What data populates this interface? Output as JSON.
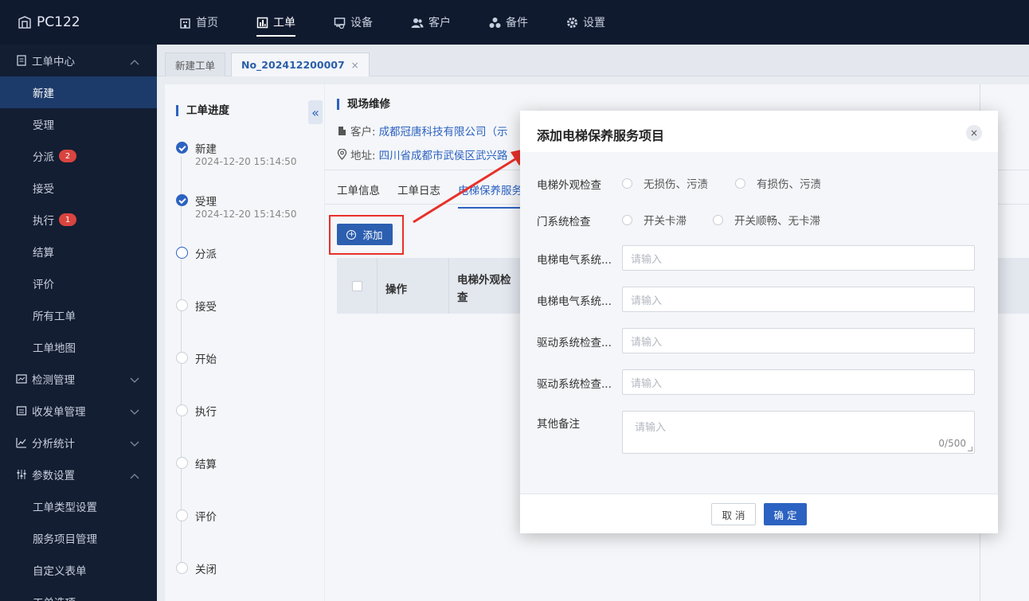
{
  "app": {
    "title": "PC122"
  },
  "nav": [
    {
      "label": "首页",
      "icon": "building-icon"
    },
    {
      "label": "工单",
      "icon": "chart-icon",
      "active": true
    },
    {
      "label": "设备",
      "icon": "device-icon"
    },
    {
      "label": "客户",
      "icon": "users-icon"
    },
    {
      "label": "备件",
      "icon": "parts-icon"
    },
    {
      "label": "设置",
      "icon": "gear-icon"
    }
  ],
  "sidebar": {
    "group_workorder": "工单中心",
    "items": [
      {
        "label": "新建",
        "active": true
      },
      {
        "label": "受理"
      },
      {
        "label": "分派",
        "badge": "2"
      },
      {
        "label": "接受"
      },
      {
        "label": "执行",
        "badge": "1"
      },
      {
        "label": "结算"
      },
      {
        "label": "评价"
      },
      {
        "label": "所有工单"
      },
      {
        "label": "工单地图"
      }
    ],
    "group_detect": "检测管理",
    "group_receipt": "收发单管理",
    "group_stats": "分析统计",
    "group_params": "参数设置",
    "param_items": [
      {
        "label": "工单类型设置"
      },
      {
        "label": "服务项目管理"
      },
      {
        "label": "自定义表单"
      },
      {
        "label": "工单选项"
      }
    ]
  },
  "tabs": [
    {
      "label": "新建工单"
    },
    {
      "label": "No_202412200007",
      "close": "×",
      "active": true
    }
  ],
  "progress": {
    "title": "工单进度",
    "steps": [
      {
        "label": "新建",
        "time": "2024-12-20 15:14:50",
        "state": "done"
      },
      {
        "label": "受理",
        "time": "2024-12-20 15:14:50",
        "state": "done"
      },
      {
        "label": "分派",
        "time": "",
        "state": "current"
      },
      {
        "label": "接受",
        "time": "",
        "state": "pending"
      },
      {
        "label": "开始",
        "time": "",
        "state": "pending"
      },
      {
        "label": "执行",
        "time": "",
        "state": "pending"
      },
      {
        "label": "结算",
        "time": "",
        "state": "pending"
      },
      {
        "label": "评价",
        "time": "",
        "state": "pending"
      },
      {
        "label": "关闭",
        "time": "",
        "state": "pending"
      }
    ]
  },
  "main": {
    "collapse": "«",
    "title": "现场维修",
    "customer_label": "客户:",
    "customer_value": "成都冠唐科技有限公司（示",
    "address_label": "地址:",
    "address_value": "四川省成都市武侯区武兴路",
    "subtabs": [
      "工单信息",
      "工单日志",
      "电梯保养服务"
    ],
    "add_button": "添加",
    "table_headers": [
      "操作",
      "电梯外观检\n查"
    ]
  },
  "modal": {
    "title": "添加电梯保养服务项目",
    "close": "×",
    "fields": [
      {
        "label": "电梯外观检查",
        "type": "radio",
        "options": [
          "无损伤、污渍",
          "有损伤、污渍"
        ]
      },
      {
        "label": "门系统检查",
        "type": "radio",
        "options": [
          "开关卡滞",
          "开关顺畅、无卡滞"
        ]
      },
      {
        "label": "电梯电气系统...",
        "type": "input",
        "placeholder": "请输入"
      },
      {
        "label": "电梯电气系统...",
        "type": "input",
        "placeholder": "请输入"
      },
      {
        "label": "驱动系统检查...",
        "type": "input",
        "placeholder": "请输入"
      },
      {
        "label": "驱动系统检查...",
        "type": "input",
        "placeholder": "请输入"
      },
      {
        "label": "其他备注",
        "type": "textarea",
        "placeholder": "请输入",
        "counter": "0/500"
      }
    ],
    "cancel": "取 消",
    "ok": "确 定"
  },
  "colors": {
    "primary": "#2c62c1",
    "highlight": "#e8302a",
    "topbar": "#101a2f",
    "sidebar": "#131e33"
  }
}
